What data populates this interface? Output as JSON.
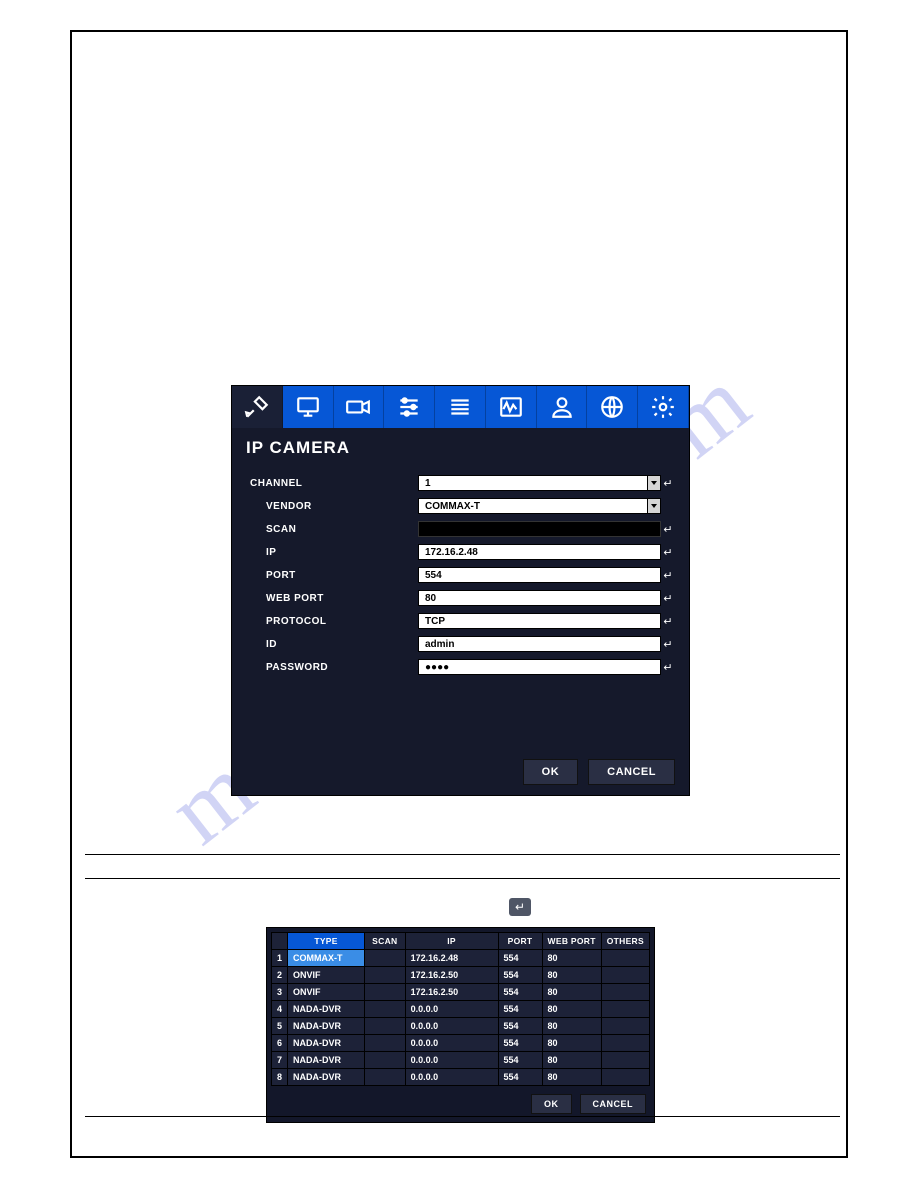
{
  "watermark": "manualshive.com",
  "panel1": {
    "title": "IP CAMERA",
    "toolbar_icons": [
      "tools",
      "monitor",
      "camera",
      "sliders",
      "list",
      "wave",
      "user",
      "globe",
      "gear"
    ],
    "fields": {
      "channel": {
        "label": "CHANNEL",
        "value": "1",
        "type": "select",
        "indent": false
      },
      "vendor": {
        "label": "VENDOR",
        "value": "COMMAX-T",
        "type": "select",
        "indent": true
      },
      "scan": {
        "label": "SCAN",
        "value": "",
        "type": "blank",
        "indent": true
      },
      "ip": {
        "label": "IP",
        "value": "172.16.2.48",
        "type": "text",
        "indent": true
      },
      "port": {
        "label": "PORT",
        "value": "554",
        "type": "text",
        "indent": true
      },
      "webport": {
        "label": "WEB PORT",
        "value": "80",
        "type": "text",
        "indent": true
      },
      "protocol": {
        "label": "PROTOCOL",
        "value": "TCP",
        "type": "text",
        "indent": true
      },
      "id": {
        "label": "ID",
        "value": "admin",
        "type": "text",
        "indent": true
      },
      "password": {
        "label": "PASSWORD",
        "value": "●●●●",
        "type": "text",
        "indent": true
      }
    },
    "buttons": {
      "ok": "OK",
      "cancel": "CANCEL"
    }
  },
  "scan_inline_icon": "↵",
  "panel2": {
    "headers": {
      "type": "TYPE",
      "scan": "SCAN",
      "ip": "IP",
      "port": "PORT",
      "webport": "WEB PORT",
      "others": "OTHERS"
    },
    "rows": [
      {
        "n": "1",
        "type": "COMMAX-T",
        "scan": "",
        "ip": "172.16.2.48",
        "port": "554",
        "webport": "80",
        "others": "",
        "selected": true
      },
      {
        "n": "2",
        "type": "ONVIF",
        "scan": "",
        "ip": "172.16.2.50",
        "port": "554",
        "webport": "80",
        "others": "",
        "selected": false
      },
      {
        "n": "3",
        "type": "ONVIF",
        "scan": "",
        "ip": "172.16.2.50",
        "port": "554",
        "webport": "80",
        "others": "",
        "selected": false
      },
      {
        "n": "4",
        "type": "NADA-DVR",
        "scan": "",
        "ip": "0.0.0.0",
        "port": "554",
        "webport": "80",
        "others": "",
        "selected": false
      },
      {
        "n": "5",
        "type": "NADA-DVR",
        "scan": "",
        "ip": "0.0.0.0",
        "port": "554",
        "webport": "80",
        "others": "",
        "selected": false
      },
      {
        "n": "6",
        "type": "NADA-DVR",
        "scan": "",
        "ip": "0.0.0.0",
        "port": "554",
        "webport": "80",
        "others": "",
        "selected": false
      },
      {
        "n": "7",
        "type": "NADA-DVR",
        "scan": "",
        "ip": "0.0.0.0",
        "port": "554",
        "webport": "80",
        "others": "",
        "selected": false
      },
      {
        "n": "8",
        "type": "NADA-DVR",
        "scan": "",
        "ip": "0.0.0.0",
        "port": "554",
        "webport": "80",
        "others": "",
        "selected": false
      }
    ],
    "buttons": {
      "ok": "OK",
      "cancel": "CANCEL"
    }
  }
}
